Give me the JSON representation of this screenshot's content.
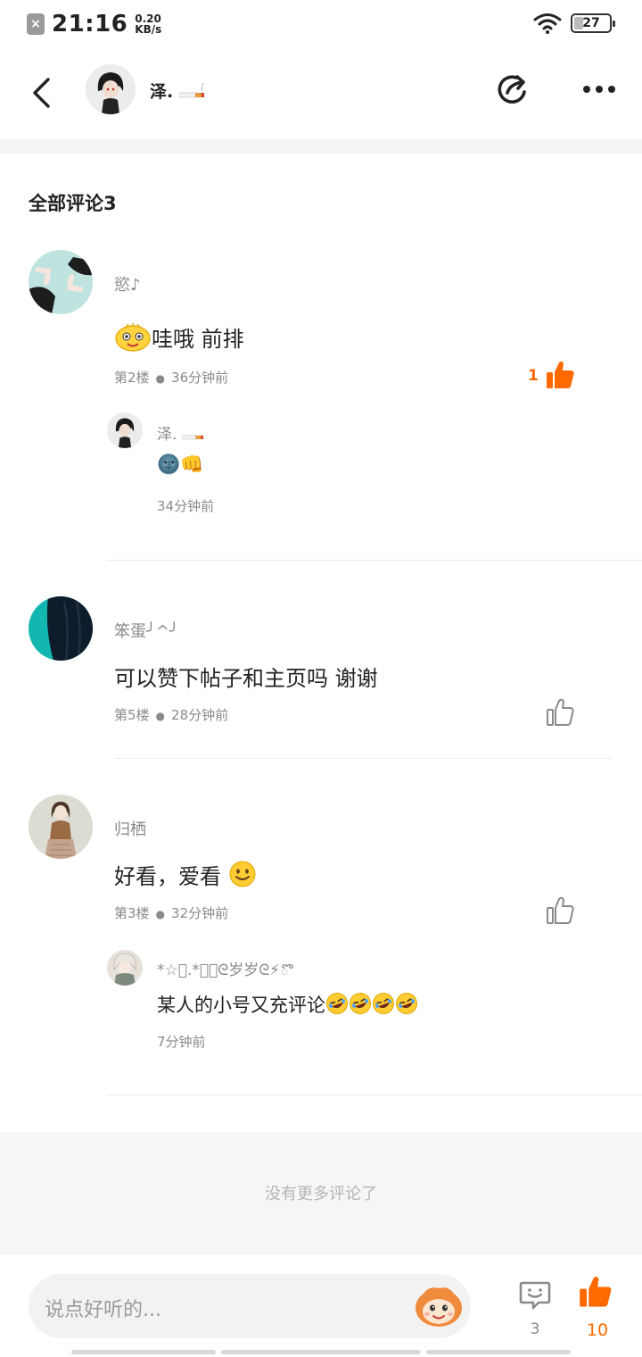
{
  "status_bar": {
    "time": "21:16",
    "speed_value": "0.20",
    "speed_unit": "KB/s",
    "battery": "27"
  },
  "header": {
    "name": "泽.",
    "title_icon": "cigarette-icon"
  },
  "comments_title": "全部评论3",
  "comments": [
    {
      "name": "慾♪",
      "text": "哇哦 前排",
      "floor": "第2楼",
      "time": "36分钟前",
      "like_count": "1",
      "liked": true,
      "reply": {
        "name": "泽.",
        "emoji_text": "🌚👊",
        "time": "34分钟前"
      }
    },
    {
      "name": "笨蛋╯^╯",
      "text": "可以赞下帖子和主页吗 谢谢",
      "floor": "第5楼",
      "time": "28分钟前",
      "like_count": "",
      "liked": false
    },
    {
      "name": "归栖",
      "text": "好看，爱看",
      "floor": "第3楼",
      "time": "32分钟前",
      "like_count": "",
      "liked": false,
      "reply": {
        "name": "*☆ﾟ.*･｡ᘓ岁岁ᘓ⚡ొ",
        "text": "某人的小号又充评论",
        "time": "7分钟前"
      }
    }
  ],
  "no_more": "没有更多评论了",
  "bottom_bar": {
    "placeholder": "说点好听的...",
    "comment_count": "3",
    "like_count": "10"
  },
  "colors": {
    "accent": "#ff6a00",
    "muted": "#8a8a8a",
    "band": "#f4f4f4"
  }
}
